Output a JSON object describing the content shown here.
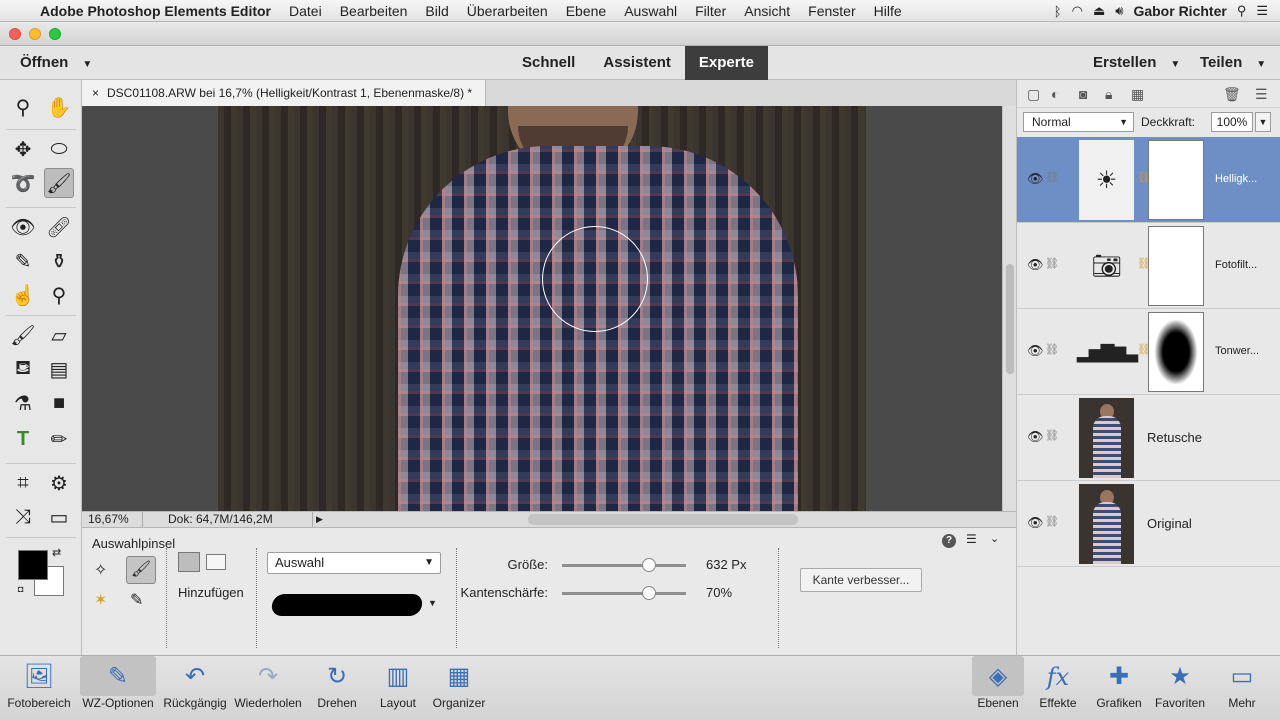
{
  "menubar": {
    "app_name": "Adobe Photoshop Elements Editor",
    "menus": [
      "Datei",
      "Bearbeiten",
      "Bild",
      "Überarbeiten",
      "Ebene",
      "Auswahl",
      "Filter",
      "Ansicht",
      "Fenster",
      "Hilfe"
    ],
    "user": "Gabor Richter"
  },
  "topbar": {
    "open_label": "Öffnen",
    "modes": [
      "Schnell",
      "Assistent",
      "Experte"
    ],
    "active_mode": "Experte",
    "create_label": "Erstellen",
    "share_label": "Teilen"
  },
  "document": {
    "tab_title": "DSC01108.ARW bei 16,7% (Helligkeit/Kontrast 1, Ebenenmaske/8) *",
    "zoom": "16,67%",
    "doc_info": "Dok: 64,7M/146,2M"
  },
  "tool_options": {
    "tool_name": "Auswahlpinsel",
    "mode_label": "Hinzufügen",
    "selection_mode": "Auswahl",
    "size_label": "Größe:",
    "size_value": "632 Px",
    "size_level": 0.7,
    "hardness_label": "Kantenschärfe:",
    "hardness_value": "70%",
    "hardness_level": 0.7,
    "refine_button": "Kante verbesser..."
  },
  "layers_panel": {
    "blend_mode": "Normal",
    "opacity_label": "Deckkraft:",
    "opacity_value": "100%",
    "layers": [
      {
        "name": "Helligk...",
        "icon": "brightness-icon",
        "selected": true
      },
      {
        "name": "Fotofilt...",
        "icon": "camera-filter-icon",
        "selected": false
      },
      {
        "name": "Tonwer...",
        "icon": "histogram-icon",
        "selected": false
      },
      {
        "name": "Retusche",
        "icon": "photo-thumbnail",
        "selected": false
      },
      {
        "name": "Original",
        "icon": "photo-thumbnail",
        "selected": false
      }
    ]
  },
  "taskbar": {
    "left": [
      "Fotobereich",
      "WZ-Optionen",
      "Rückgängig",
      "Wiederholen",
      "Drehen",
      "Layout",
      "Organizer"
    ],
    "right": [
      "Ebenen",
      "Effekte",
      "Grafiken",
      "Favoriten",
      "Mehr"
    ]
  },
  "colors": {
    "accent_selected_layer": "#6e8fc6",
    "active_mode_tab": "#3d3d3d",
    "foreground_color": "#000000",
    "background_color": "#ffffff"
  }
}
